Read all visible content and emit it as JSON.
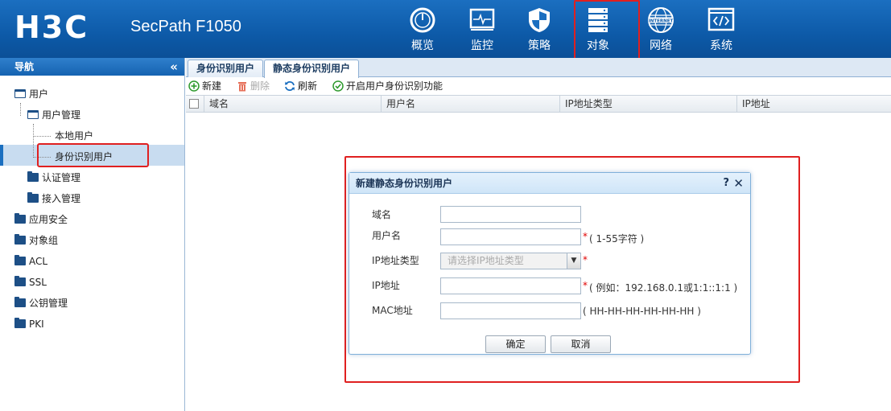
{
  "header": {
    "logo_text": "H3C",
    "product": "SecPath F1050",
    "nav": [
      {
        "label": "概览",
        "icon": "gauge-icon"
      },
      {
        "label": "监控",
        "icon": "monitor-icon"
      },
      {
        "label": "策略",
        "icon": "shield-icon"
      },
      {
        "label": "对象",
        "icon": "server-stack-icon"
      },
      {
        "label": "网络",
        "icon": "internet-globe-icon"
      },
      {
        "label": "系统",
        "icon": "code-window-icon"
      }
    ],
    "globe_text": "INTERNET",
    "active_nav": "对象"
  },
  "sidebar": {
    "title": "导航",
    "collapse": "«",
    "items": [
      {
        "label": "用户"
      },
      {
        "label": "用户管理"
      },
      {
        "label": "本地用户"
      },
      {
        "label": "身份识别用户"
      },
      {
        "label": "认证管理"
      },
      {
        "label": "接入管理"
      },
      {
        "label": "应用安全"
      },
      {
        "label": "对象组"
      },
      {
        "label": "ACL"
      },
      {
        "label": "SSL"
      },
      {
        "label": "公钥管理"
      },
      {
        "label": "PKI"
      }
    ],
    "selected": "身份识别用户"
  },
  "tabs": [
    {
      "label": "身份识别用户"
    },
    {
      "label": "静态身份识别用户"
    }
  ],
  "toolbar": {
    "new": "新建",
    "delete": "删除",
    "refresh": "刷新",
    "enable": "开启用户身份识别功能"
  },
  "grid": {
    "columns": [
      "域名",
      "用户名",
      "IP地址类型",
      "IP地址"
    ]
  },
  "dialog": {
    "title": "新建静态身份识别用户",
    "help": "?",
    "close": "✕",
    "fields": {
      "domain": {
        "label": "域名",
        "value": ""
      },
      "username": {
        "label": "用户名",
        "value": "",
        "required": "*",
        "hint": "( 1-55字符 )"
      },
      "ip_type": {
        "label": "IP地址类型",
        "placeholder": "请选择IP地址类型",
        "required": "*"
      },
      "ip": {
        "label": "IP地址",
        "value": "",
        "required": "*",
        "hint": "( 例如：192.168.0.1或1:1::1:1 )"
      },
      "mac": {
        "label": "MAC地址",
        "value": "",
        "hint": "( HH-HH-HH-HH-HH-HH )"
      }
    },
    "ok": "确定",
    "cancel": "取消"
  },
  "colors": {
    "header": "#0d5aa8",
    "highlight": "#e02020",
    "selected_row": "#c8dcf0"
  }
}
